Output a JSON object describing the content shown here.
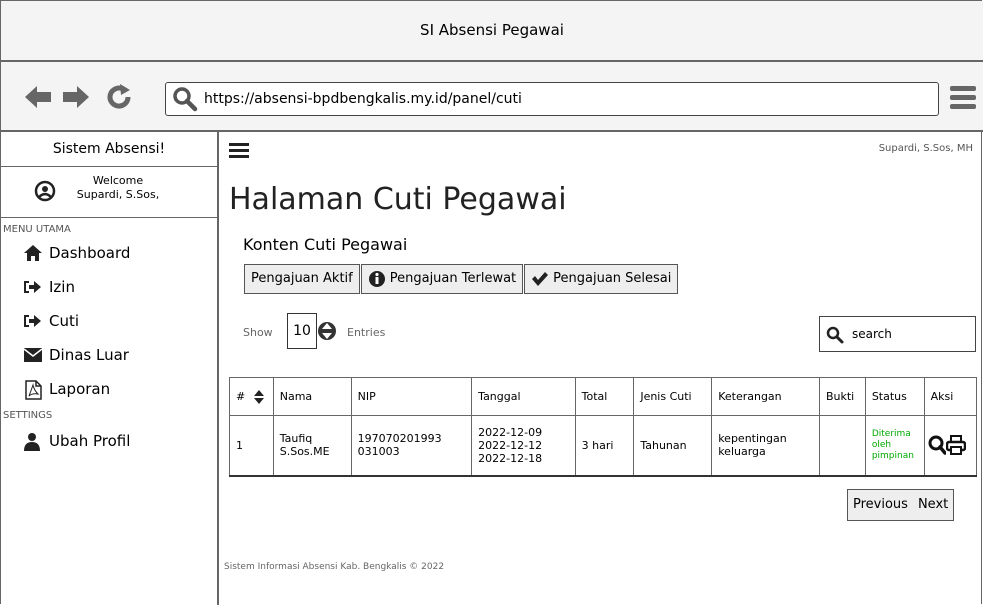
{
  "window": {
    "title": "SI Absensi Pegawai"
  },
  "browser": {
    "url": "https://absensi-bpdbengkalis.my.id/panel/cuti",
    "back_icon": "arrow-left-icon",
    "forward_icon": "arrow-right-icon",
    "reload_icon": "refresh-icon",
    "menu_icon": "hamburger-icon"
  },
  "sidebar": {
    "title": "Sistem Absensi!",
    "welcome": "Welcome",
    "user": "Supardi, S.Sos,",
    "section_main": "MENU UTAMA",
    "items": [
      {
        "label": "Dashboard",
        "icon": "home-icon"
      },
      {
        "label": "Izin",
        "icon": "sign-in-icon"
      },
      {
        "label": "Cuti",
        "icon": "sign-in-icon"
      },
      {
        "label": "Dinas Luar",
        "icon": "envelope-icon"
      },
      {
        "label": "Laporan",
        "icon": "pdf-file-icon"
      }
    ],
    "section_settings": "SETTINGS",
    "settings_items": [
      {
        "label": "Ubah Profil",
        "icon": "user-icon"
      }
    ]
  },
  "header": {
    "user": "Supardi, S.Sos, MH"
  },
  "main": {
    "title": "Halaman Cuti Pegawai",
    "subtitle": "Konten Cuti Pegawai",
    "tabs": [
      {
        "label": "Pengajuan Aktif"
      },
      {
        "label": "Pengajuan Terlewat",
        "icon": "info-icon"
      },
      {
        "label": "Pengajuan Selesai",
        "icon": "check-icon"
      }
    ],
    "show_label": "Show",
    "entries_value": "10",
    "entries_label": "Entries",
    "search_placeholder": "search",
    "table": {
      "headers": [
        "#",
        "Nama",
        "NIP",
        "Tanggal",
        "Total",
        "Jenis Cuti",
        "Keterangan",
        "Bukti",
        "Status",
        "Aksi"
      ],
      "rows": [
        {
          "no": "1",
          "nama": "Taufiq S.Sos.ME",
          "nip": "197070201993 031003",
          "tanggal": [
            "2022-12-09",
            "2022-12-12",
            "2022-12-18"
          ],
          "total": "3 hari",
          "jenis": "Tahunan",
          "keterangan": "kepentingan keluarga",
          "bukti": "",
          "status": "Diterima oleh pimpinan"
        }
      ]
    },
    "pager": {
      "previous": "Previous",
      "next": "Next"
    },
    "footer": "Sistem Informasi Absensi Kab. Bengkalis © 2022"
  }
}
